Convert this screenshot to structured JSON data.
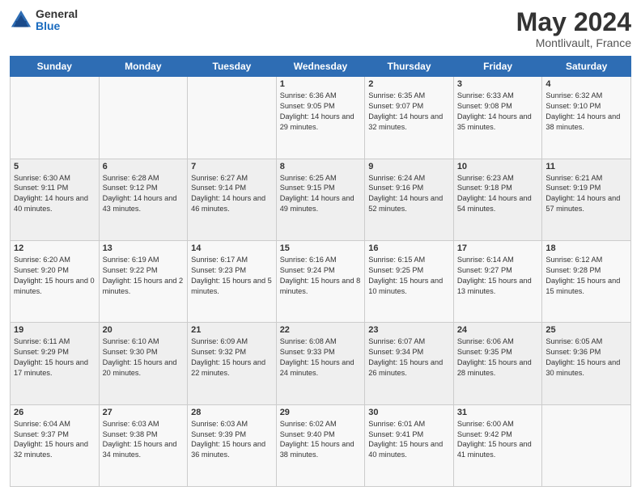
{
  "header": {
    "logo": {
      "general": "General",
      "blue": "Blue"
    },
    "title": "May 2024",
    "location": "Montlivault, France"
  },
  "days_of_week": [
    "Sunday",
    "Monday",
    "Tuesday",
    "Wednesday",
    "Thursday",
    "Friday",
    "Saturday"
  ],
  "weeks": [
    [
      {
        "day": "",
        "sunrise": "",
        "sunset": "",
        "daylight": ""
      },
      {
        "day": "",
        "sunrise": "",
        "sunset": "",
        "daylight": ""
      },
      {
        "day": "",
        "sunrise": "",
        "sunset": "",
        "daylight": ""
      },
      {
        "day": "1",
        "sunrise": "Sunrise: 6:36 AM",
        "sunset": "Sunset: 9:05 PM",
        "daylight": "Daylight: 14 hours and 29 minutes."
      },
      {
        "day": "2",
        "sunrise": "Sunrise: 6:35 AM",
        "sunset": "Sunset: 9:07 PM",
        "daylight": "Daylight: 14 hours and 32 minutes."
      },
      {
        "day": "3",
        "sunrise": "Sunrise: 6:33 AM",
        "sunset": "Sunset: 9:08 PM",
        "daylight": "Daylight: 14 hours and 35 minutes."
      },
      {
        "day": "4",
        "sunrise": "Sunrise: 6:32 AM",
        "sunset": "Sunset: 9:10 PM",
        "daylight": "Daylight: 14 hours and 38 minutes."
      }
    ],
    [
      {
        "day": "5",
        "sunrise": "Sunrise: 6:30 AM",
        "sunset": "Sunset: 9:11 PM",
        "daylight": "Daylight: 14 hours and 40 minutes."
      },
      {
        "day": "6",
        "sunrise": "Sunrise: 6:28 AM",
        "sunset": "Sunset: 9:12 PM",
        "daylight": "Daylight: 14 hours and 43 minutes."
      },
      {
        "day": "7",
        "sunrise": "Sunrise: 6:27 AM",
        "sunset": "Sunset: 9:14 PM",
        "daylight": "Daylight: 14 hours and 46 minutes."
      },
      {
        "day": "8",
        "sunrise": "Sunrise: 6:25 AM",
        "sunset": "Sunset: 9:15 PM",
        "daylight": "Daylight: 14 hours and 49 minutes."
      },
      {
        "day": "9",
        "sunrise": "Sunrise: 6:24 AM",
        "sunset": "Sunset: 9:16 PM",
        "daylight": "Daylight: 14 hours and 52 minutes."
      },
      {
        "day": "10",
        "sunrise": "Sunrise: 6:23 AM",
        "sunset": "Sunset: 9:18 PM",
        "daylight": "Daylight: 14 hours and 54 minutes."
      },
      {
        "day": "11",
        "sunrise": "Sunrise: 6:21 AM",
        "sunset": "Sunset: 9:19 PM",
        "daylight": "Daylight: 14 hours and 57 minutes."
      }
    ],
    [
      {
        "day": "12",
        "sunrise": "Sunrise: 6:20 AM",
        "sunset": "Sunset: 9:20 PM",
        "daylight": "Daylight: 15 hours and 0 minutes."
      },
      {
        "day": "13",
        "sunrise": "Sunrise: 6:19 AM",
        "sunset": "Sunset: 9:22 PM",
        "daylight": "Daylight: 15 hours and 2 minutes."
      },
      {
        "day": "14",
        "sunrise": "Sunrise: 6:17 AM",
        "sunset": "Sunset: 9:23 PM",
        "daylight": "Daylight: 15 hours and 5 minutes."
      },
      {
        "day": "15",
        "sunrise": "Sunrise: 6:16 AM",
        "sunset": "Sunset: 9:24 PM",
        "daylight": "Daylight: 15 hours and 8 minutes."
      },
      {
        "day": "16",
        "sunrise": "Sunrise: 6:15 AM",
        "sunset": "Sunset: 9:25 PM",
        "daylight": "Daylight: 15 hours and 10 minutes."
      },
      {
        "day": "17",
        "sunrise": "Sunrise: 6:14 AM",
        "sunset": "Sunset: 9:27 PM",
        "daylight": "Daylight: 15 hours and 13 minutes."
      },
      {
        "day": "18",
        "sunrise": "Sunrise: 6:12 AM",
        "sunset": "Sunset: 9:28 PM",
        "daylight": "Daylight: 15 hours and 15 minutes."
      }
    ],
    [
      {
        "day": "19",
        "sunrise": "Sunrise: 6:11 AM",
        "sunset": "Sunset: 9:29 PM",
        "daylight": "Daylight: 15 hours and 17 minutes."
      },
      {
        "day": "20",
        "sunrise": "Sunrise: 6:10 AM",
        "sunset": "Sunset: 9:30 PM",
        "daylight": "Daylight: 15 hours and 20 minutes."
      },
      {
        "day": "21",
        "sunrise": "Sunrise: 6:09 AM",
        "sunset": "Sunset: 9:32 PM",
        "daylight": "Daylight: 15 hours and 22 minutes."
      },
      {
        "day": "22",
        "sunrise": "Sunrise: 6:08 AM",
        "sunset": "Sunset: 9:33 PM",
        "daylight": "Daylight: 15 hours and 24 minutes."
      },
      {
        "day": "23",
        "sunrise": "Sunrise: 6:07 AM",
        "sunset": "Sunset: 9:34 PM",
        "daylight": "Daylight: 15 hours and 26 minutes."
      },
      {
        "day": "24",
        "sunrise": "Sunrise: 6:06 AM",
        "sunset": "Sunset: 9:35 PM",
        "daylight": "Daylight: 15 hours and 28 minutes."
      },
      {
        "day": "25",
        "sunrise": "Sunrise: 6:05 AM",
        "sunset": "Sunset: 9:36 PM",
        "daylight": "Daylight: 15 hours and 30 minutes."
      }
    ],
    [
      {
        "day": "26",
        "sunrise": "Sunrise: 6:04 AM",
        "sunset": "Sunset: 9:37 PM",
        "daylight": "Daylight: 15 hours and 32 minutes."
      },
      {
        "day": "27",
        "sunrise": "Sunrise: 6:03 AM",
        "sunset": "Sunset: 9:38 PM",
        "daylight": "Daylight: 15 hours and 34 minutes."
      },
      {
        "day": "28",
        "sunrise": "Sunrise: 6:03 AM",
        "sunset": "Sunset: 9:39 PM",
        "daylight": "Daylight: 15 hours and 36 minutes."
      },
      {
        "day": "29",
        "sunrise": "Sunrise: 6:02 AM",
        "sunset": "Sunset: 9:40 PM",
        "daylight": "Daylight: 15 hours and 38 minutes."
      },
      {
        "day": "30",
        "sunrise": "Sunrise: 6:01 AM",
        "sunset": "Sunset: 9:41 PM",
        "daylight": "Daylight: 15 hours and 40 minutes."
      },
      {
        "day": "31",
        "sunrise": "Sunrise: 6:00 AM",
        "sunset": "Sunset: 9:42 PM",
        "daylight": "Daylight: 15 hours and 41 minutes."
      },
      {
        "day": "",
        "sunrise": "",
        "sunset": "",
        "daylight": ""
      }
    ]
  ]
}
